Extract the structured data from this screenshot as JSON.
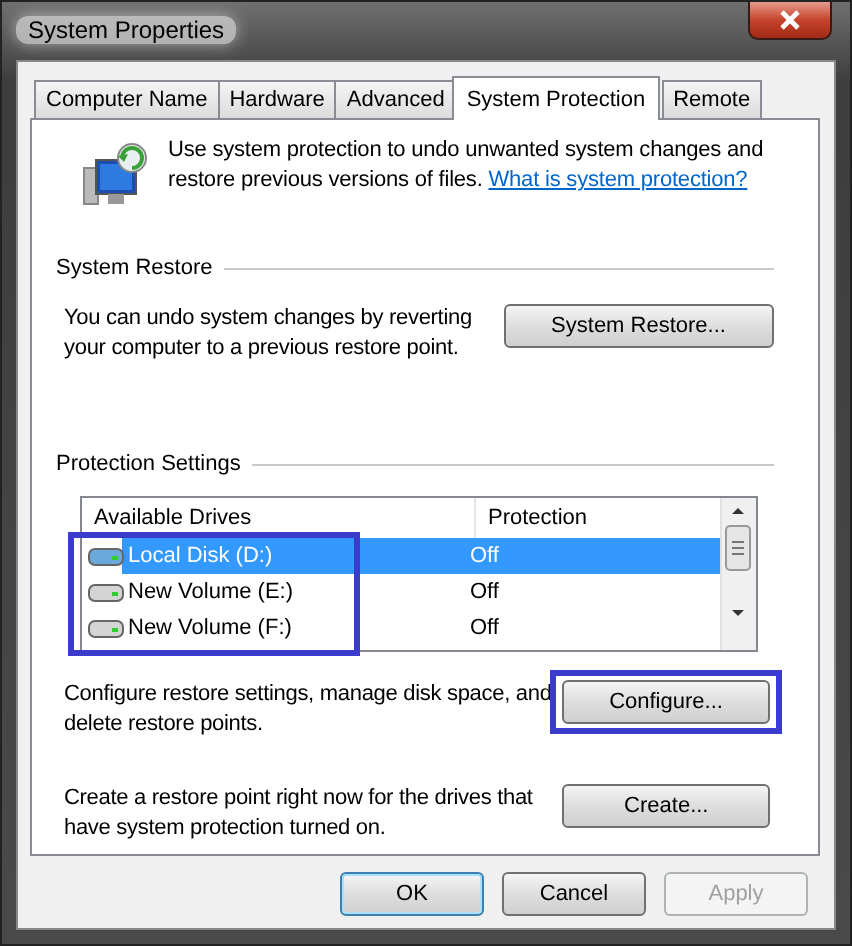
{
  "window": {
    "title": "System Properties"
  },
  "tabs": [
    {
      "label": "Computer Name",
      "selected": false
    },
    {
      "label": "Hardware",
      "selected": false
    },
    {
      "label": "Advanced",
      "selected": false
    },
    {
      "label": "System Protection",
      "selected": true
    },
    {
      "label": "Remote",
      "selected": false
    }
  ],
  "intro": {
    "text": "Use system protection to undo unwanted system changes and restore previous versions of files.",
    "link": "What is system protection?"
  },
  "system_restore": {
    "heading": "System Restore",
    "text": "You can undo system changes by reverting your computer to a previous restore point.",
    "button": "System Restore..."
  },
  "protection_settings": {
    "heading": "Protection Settings",
    "columns": [
      "Available Drives",
      "Protection"
    ],
    "rows": [
      {
        "drive": "Local Disk (D:)",
        "protection": "Off",
        "selected": true
      },
      {
        "drive": "New Volume (E:)",
        "protection": "Off",
        "selected": false
      },
      {
        "drive": "New Volume (F:)",
        "protection": "Off",
        "selected": false
      }
    ],
    "configure_text": "Configure restore settings, manage disk space, and delete restore points.",
    "configure_button": "Configure...",
    "create_text": "Create a restore point right now for the drives that have system protection turned on.",
    "create_button": "Create..."
  },
  "buttons": [
    {
      "label": "OK",
      "default": true,
      "disabled": false
    },
    {
      "label": "Cancel",
      "default": false,
      "disabled": false
    },
    {
      "label": "Apply",
      "default": false,
      "disabled": true
    }
  ]
}
